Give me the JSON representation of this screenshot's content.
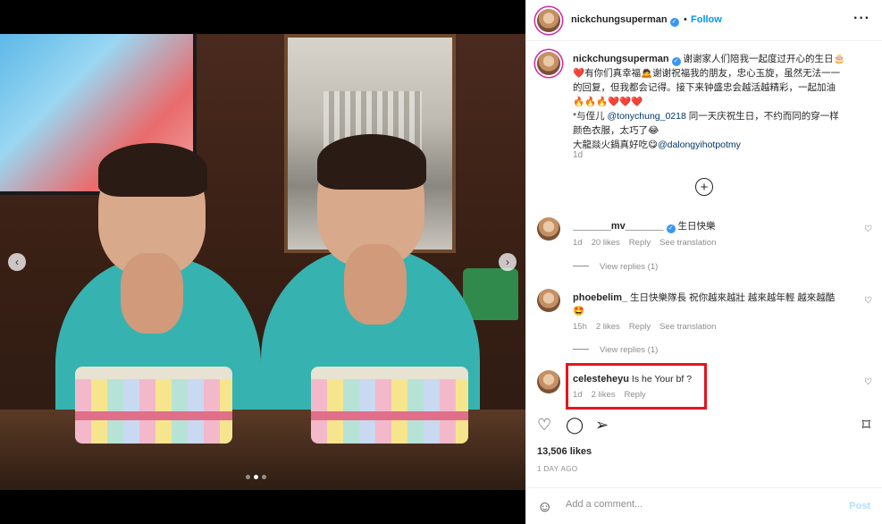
{
  "post": {
    "username": "nickchungsuperman",
    "follow_label": "Follow",
    "dot": "•",
    "more": "···",
    "caption": {
      "username": "nickchungsuperman",
      "line1": "谢谢家人们陪我一起度过开心的生日🎂",
      "line2": "❤️有你们真幸福🙇谢谢祝福我的朋友，忠心玉旋，虽然无法一一",
      "line3": "的回复，但我都会记得。接下来钟盛忠会越活越精彩，一起加油",
      "line4": "🔥🔥🔥❤️❤️❤️",
      "line5_pre": "*与侄儿 ",
      "line5_tag": "@tonychung_0218",
      "line5_post": " 同一天庆祝生日，不约而同的穿一样",
      "line6": "颜色衣服，太巧了😂",
      "line7_pre": "大龍燚火鍋真好吃😋",
      "line7_tag": "@dalongyihotpotmy",
      "time": "1d"
    },
    "comments": [
      {
        "username": "_______mv_______",
        "text": "生日快樂",
        "time": "1d",
        "likes": "20 likes",
        "reply": "Reply",
        "translate": "See translation",
        "view_replies": "View replies (1)"
      },
      {
        "username": "phoebelim_",
        "text": "生日快樂隊長 祝你越來越壯 越來越年輕 越來越酷",
        "emoji": "🤩",
        "time": "15h",
        "likes": "2 likes",
        "reply": "Reply",
        "translate": "See translation",
        "view_replies": "View replies (1)"
      },
      {
        "username": "celesteheyu",
        "text": "Is he Your bf ?",
        "time": "1d",
        "likes": "2 likes",
        "reply": "Reply"
      }
    ],
    "likes_count": "13,506 likes",
    "date": "1 DAY AGO",
    "composer": {
      "placeholder": "Add a comment...",
      "post_label": "Post"
    }
  },
  "media": {
    "prev": "‹",
    "next": "›",
    "slide_count": 3,
    "active_slide": 2
  },
  "colors": {
    "link": "#0095f6",
    "highlight": "#e8131c",
    "heart": "#ed4956"
  }
}
